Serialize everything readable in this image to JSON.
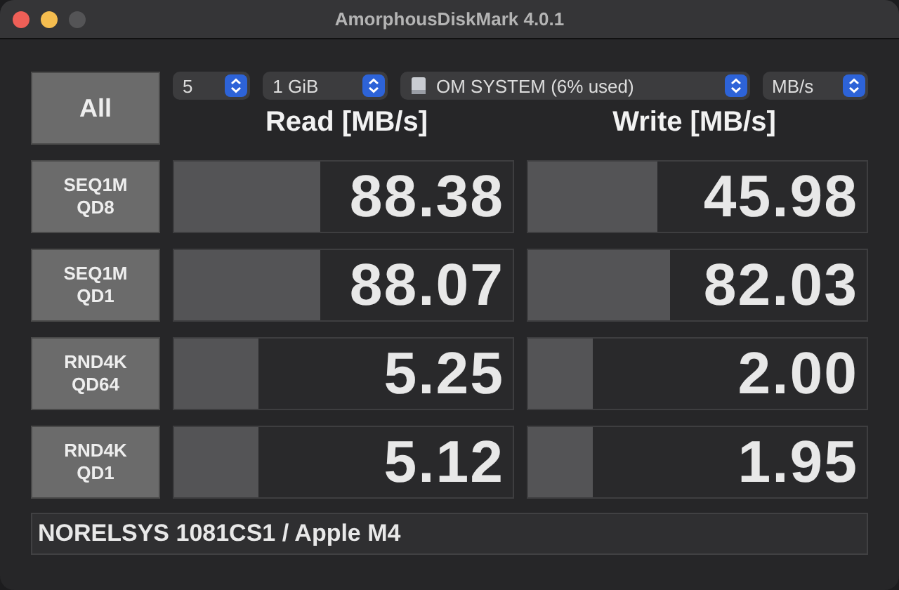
{
  "window": {
    "title": "AmorphousDiskMark 4.0.1"
  },
  "all_button": "All",
  "selectors": [
    {
      "kind": "count",
      "value": "5"
    },
    {
      "kind": "size",
      "value": "1 GiB"
    },
    {
      "kind": "drive",
      "value": "OM SYSTEM (6% used)"
    },
    {
      "kind": "unit",
      "value": "MB/s"
    }
  ],
  "headers": [
    "Read [MB/s]",
    "Write [MB/s]"
  ],
  "tests": [
    {
      "label": "SEQ1M\nQD8",
      "read": {
        "value": "88.38",
        "level": 0.43
      },
      "write": {
        "value": "45.98",
        "level": 0.38
      }
    },
    {
      "label": "SEQ1M\nQD1",
      "read": {
        "value": "88.07",
        "level": 0.43
      },
      "write": {
        "value": "82.03",
        "level": 0.42
      }
    },
    {
      "label": "RND4K\nQD64",
      "read": {
        "value": "5.25",
        "level": 0.25
      },
      "write": {
        "value": "2.00",
        "level": 0.19
      }
    },
    {
      "label": "RND4K\nQD1",
      "read": {
        "value": "5.12",
        "level": 0.25
      },
      "write": {
        "value": "1.95",
        "level": 0.19
      }
    }
  ],
  "status_bar": "NORELSYS 1081CS1 / Apple M4"
}
